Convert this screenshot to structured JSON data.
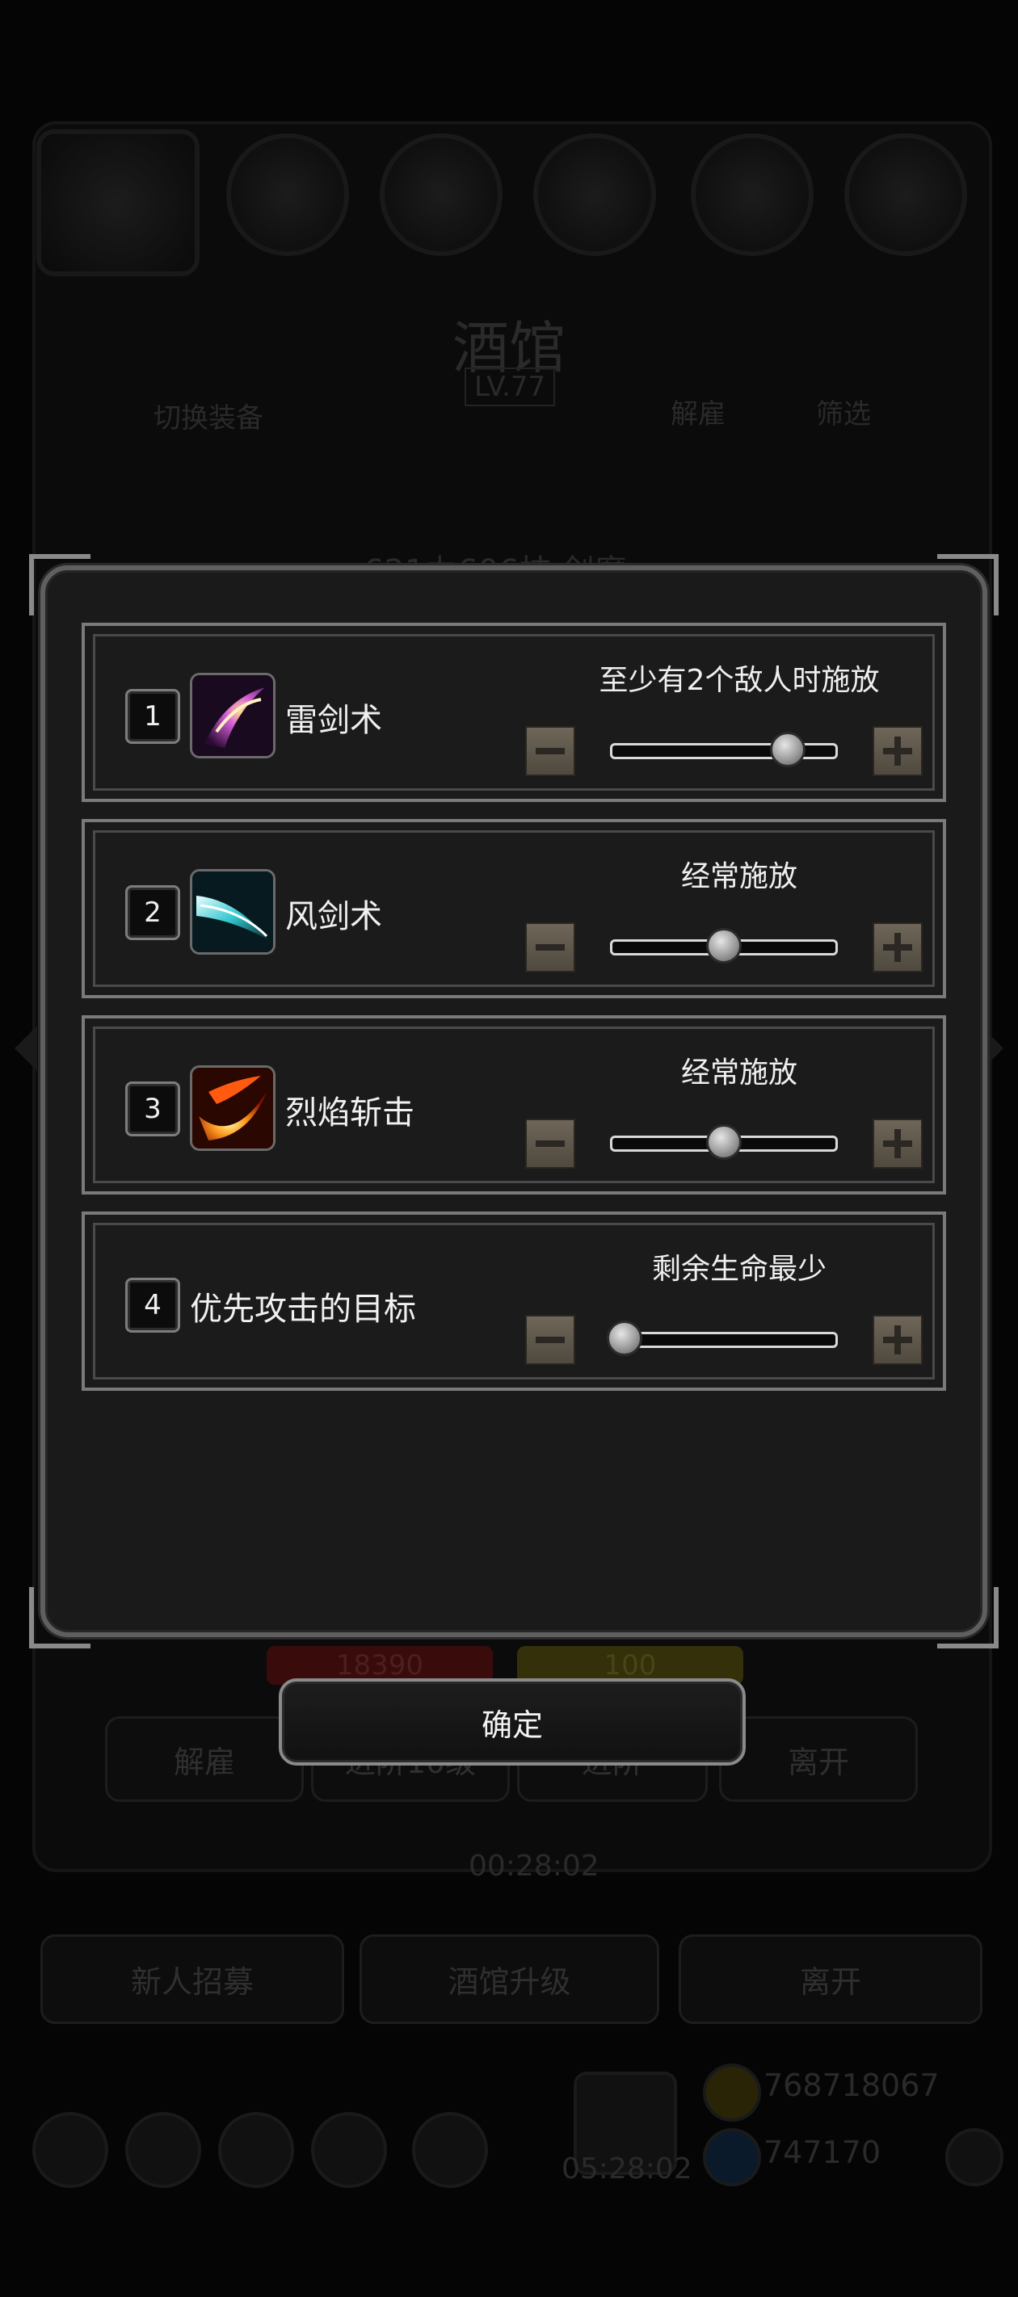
{
  "background": {
    "title": "酒馆",
    "level": "LV.77",
    "switch_label": "切换装备",
    "dismiss_top": "解雇",
    "filter_label": "筛选",
    "hero_name": "621力606技·剑魔",
    "hp_value": "18390",
    "energy_value": "100",
    "buttons": [
      "解雇",
      "进阶10级",
      "进阶",
      "离开"
    ],
    "timer1": "00:28:02",
    "bottom_buttons": [
      "新人招募",
      "酒馆升级",
      "离开"
    ],
    "gold": "768718067",
    "gems": "747170",
    "timer2": "05:28:02"
  },
  "dialog": {
    "rows": [
      {
        "num": "1",
        "name": "雷剑术",
        "mode": "至少有2个敌人时施放",
        "level": 0.82,
        "icon": "thunder-sword-icon"
      },
      {
        "num": "2",
        "name": "风剑术",
        "mode": "经常施放",
        "level": 0.5,
        "icon": "wind-sword-icon"
      },
      {
        "num": "3",
        "name": "烈焰斩击",
        "mode": "经常施放",
        "level": 0.5,
        "icon": "flame-slash-icon"
      },
      {
        "num": "4",
        "name": "优先攻击的目标",
        "mode": "剩余生命最少",
        "level": 0.0,
        "icon": ""
      }
    ],
    "confirm_label": "确定"
  },
  "colors": {
    "panel": "#1a1a1a",
    "frame": "#7a7a7a",
    "stepper": "#6e6658"
  }
}
